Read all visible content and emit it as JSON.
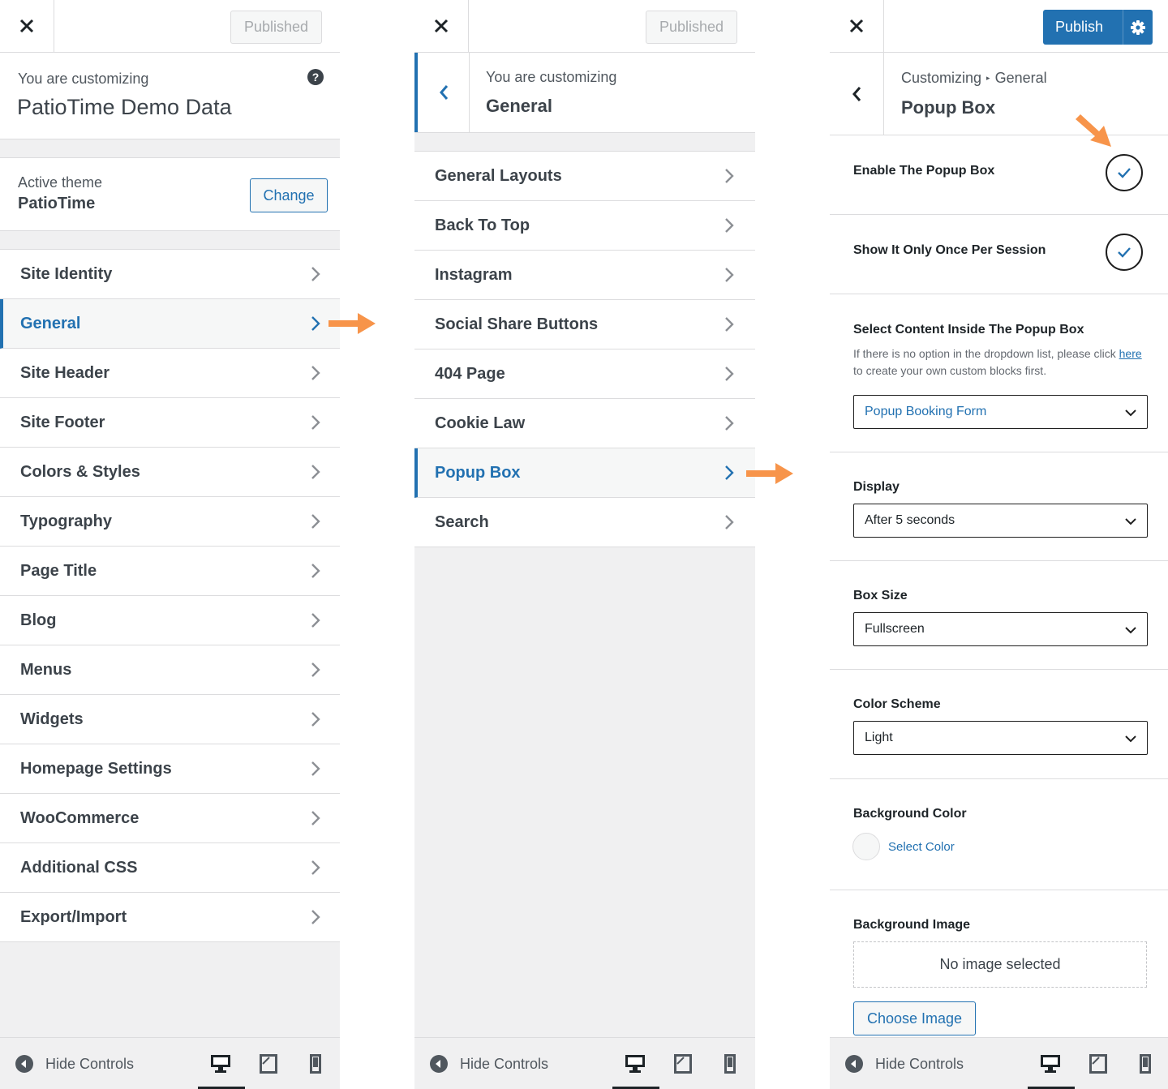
{
  "panel1": {
    "published_label": "Published",
    "customizing_label": "You are customizing",
    "site_name": "PatioTime Demo Data",
    "help_glyph": "?",
    "active_theme_label": "Active theme",
    "theme_name": "PatioTime",
    "change_label": "Change",
    "menu": [
      {
        "label": "Site Identity"
      },
      {
        "label": "General"
      },
      {
        "label": "Site Header"
      },
      {
        "label": "Site Footer"
      },
      {
        "label": "Colors & Styles"
      },
      {
        "label": "Typography"
      },
      {
        "label": "Page Title"
      },
      {
        "label": "Blog"
      },
      {
        "label": "Menus"
      },
      {
        "label": "Widgets"
      },
      {
        "label": "Homepage Settings"
      },
      {
        "label": "WooCommerce"
      },
      {
        "label": "Additional CSS"
      },
      {
        "label": "Export/Import"
      }
    ],
    "active_menu": "General",
    "hide_controls": "Hide Controls"
  },
  "panel2": {
    "published_label": "Published",
    "customizing_label": "You are customizing",
    "section_title": "General",
    "menu": [
      {
        "label": "General Layouts"
      },
      {
        "label": "Back To Top"
      },
      {
        "label": "Instagram"
      },
      {
        "label": "Social Share Buttons"
      },
      {
        "label": "404 Page"
      },
      {
        "label": "Cookie Law"
      },
      {
        "label": "Popup Box"
      },
      {
        "label": "Search"
      }
    ],
    "active_menu": "Popup Box",
    "hide_controls": "Hide Controls"
  },
  "panel3": {
    "publish_label": "Publish",
    "breadcrumb_root": "Customizing",
    "breadcrumb_parent": "General",
    "breadcrumb_separator": "▸",
    "section_title": "Popup Box",
    "enable_label": "Enable The Popup Box",
    "enable_checked": true,
    "once_label": "Show It Only Once Per Session",
    "once_checked": true,
    "content_label": "Select Content Inside The Popup Box",
    "content_desc_before": "If there is no option in the dropdown list, please click ",
    "content_desc_link": "here",
    "content_desc_after": " to create your own custom blocks first.",
    "content_value": "Popup Booking Form",
    "display_label": "Display",
    "display_value": "After 5 seconds",
    "size_label": "Box Size",
    "size_value": "Fullscreen",
    "scheme_label": "Color Scheme",
    "scheme_value": "Light",
    "bgcolor_label": "Background Color",
    "select_color_label": "Select Color",
    "bgimage_label": "Background Image",
    "no_image_label": "No image selected",
    "choose_image_label": "Choose Image",
    "hide_controls": "Hide Controls"
  },
  "colors": {
    "accent": "#2271b1",
    "arrow": "#f7944a",
    "panel_bg": "#f0f0f1"
  }
}
